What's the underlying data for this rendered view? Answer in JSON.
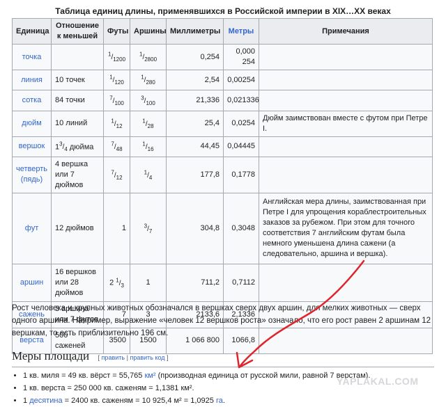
{
  "caption": "Таблица единиц длины, применявшихся в Российской империи в XIX…XX веках",
  "headers": [
    "Единица",
    "Отношение к меньшей",
    "Футы",
    "Аршины",
    "Миллиметры",
    "Метры",
    "Примечания"
  ],
  "rows": [
    {
      "unit": "точка",
      "relation": "",
      "feet_num": "1",
      "feet_den": "1200",
      "arsh_num": "1",
      "arsh_den": "2800",
      "mm": "0,254",
      "m": "0,000 254",
      "note": ""
    },
    {
      "unit": "линия",
      "relation": "10 точек",
      "feet_num": "1",
      "feet_den": "120",
      "arsh_num": "1",
      "arsh_den": "280",
      "mm": "2,54",
      "m": "0,00254",
      "note": ""
    },
    {
      "unit": "сотка",
      "relation": "84 точки",
      "feet_num": "7",
      "feet_den": "100",
      "arsh_num": "3",
      "arsh_den": "100",
      "mm": "21,336",
      "m": "0,021336",
      "note": ""
    },
    {
      "unit": "дюйм",
      "relation": "10 линий",
      "feet_num": "1",
      "feet_den": "12",
      "arsh_num": "1",
      "arsh_den": "28",
      "mm": "25,4",
      "m": "0,0254",
      "note": "Дюйм заимствован вместе с футом при Петре I."
    },
    {
      "unit": "вершок",
      "relation_int": "1",
      "relation_num": "3",
      "relation_den": "4",
      "relation_rest": "дюйма",
      "feet_num": "7",
      "feet_den": "48",
      "arsh_num": "1",
      "arsh_den": "16",
      "mm": "44,45",
      "m": "0,04445",
      "note": ""
    },
    {
      "unit": "четверть (пядь)",
      "relation": "4 вершка или 7 дюймов",
      "feet_num": "7",
      "feet_den": "12",
      "arsh_num": "1",
      "arsh_den": "4",
      "mm": "177,8",
      "m": "0,1778",
      "note": ""
    },
    {
      "unit": "фут",
      "relation": "12 дюймов",
      "feet": "1",
      "arsh_num": "3",
      "arsh_den": "7",
      "mm": "304,8",
      "m": "0,3048",
      "note": "Английская мера длины, заимствованная при Петре I для упрощения кораблестроительных заказов за рубежом. При этом для точного соответствия 7 английским футам была немного уменьшена длина сажени (а следовательно, аршина и вершка)."
    },
    {
      "unit": "аршин",
      "relation": "16 вершков или 28 дюймов",
      "feet_int": "2",
      "feet_num": "1",
      "feet_den": "3",
      "arsh": "1",
      "mm": "711,2",
      "m": "0,7112",
      "note": ""
    },
    {
      "unit": "сажень",
      "relation": "3 аршина или 7 футов",
      "feet": "7",
      "arsh": "3",
      "mm": "2133,6",
      "m": "2,1336",
      "note": ""
    },
    {
      "unit": "верста",
      "relation": "500 саженей",
      "feet": "3500",
      "arsh": "1500",
      "mm": "1 066 800",
      "m": "1066,8",
      "note": ""
    }
  ],
  "paragraph": "Рост человека и крупных животных обозначался в вершках сверх двух аршин, для мелких животных — сверх одного аршина. Например, выражение «человек 12 вершков роста» означало, что его рост равен 2 аршинам 12 вершкам, то есть приблизительно 196 см.",
  "section": {
    "title": "Меры площади",
    "edit_open": "[",
    "edit_label": "править",
    "edit_sep": "|",
    "edit_code_label": "править код",
    "edit_close": "]"
  },
  "bullets": {
    "b1_text": "1 кв. миля = 49 кв. вёрст = 55,765 ",
    "b1_link": "км²",
    "b1_rest": " (производная единица от русской мили, равной 7 верстам).",
    "b2_text": "1 кв. верста = 250 000 кв. саженям = 1,1381 км².",
    "b3_pre": "1 ",
    "b3_link1": "десятина",
    "b3_mid": " = 2400 кв. саженям = 10 925,4 м² = 1,0925 ",
    "b3_link2": "га",
    "b3_end": "."
  },
  "watermark": "YAPLAKAL.COM",
  "colors": {
    "link": "#3366cc",
    "arrow": "#e0242b",
    "header_bg": "#eaecf0",
    "cell_bg": "#f8f9fa",
    "border": "#a2a9b1"
  }
}
